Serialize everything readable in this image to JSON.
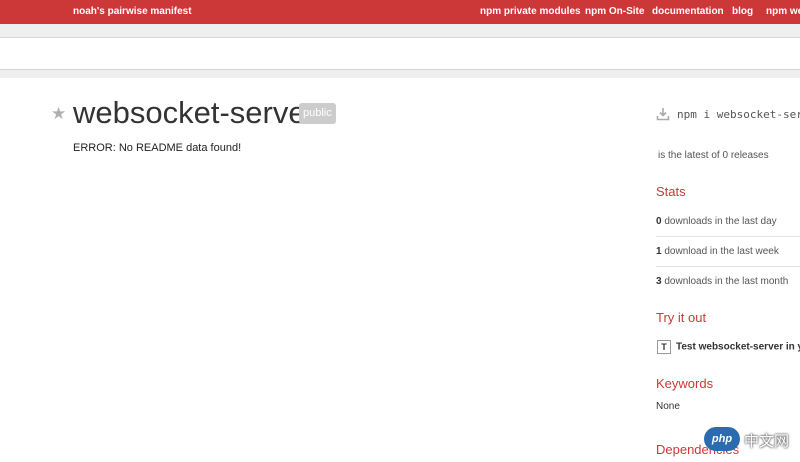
{
  "topbar": {
    "tagline": "noah's pairwise manifest",
    "nav": [
      "npm private modules",
      "npm On-Site",
      "documentation",
      "blog",
      "npm we"
    ]
  },
  "package": {
    "name": "websocket-server",
    "visibility": "public",
    "readme_error": "ERROR: No README data found!"
  },
  "sidebar": {
    "install_cmd": "npm i websocket-ser",
    "latest_text": "is the latest of 0 releases",
    "stats": {
      "title": "Stats",
      "rows": [
        {
          "count": "0",
          "label": "downloads in the last day"
        },
        {
          "count": "1",
          "label": "download in the last week"
        },
        {
          "count": "3",
          "label": "downloads in the last month"
        }
      ]
    },
    "try": {
      "title": "Try it out",
      "box_letter": "T",
      "text": "Test websocket-server in y"
    },
    "keywords": {
      "title": "Keywords",
      "value": "None"
    },
    "dependencies_title": "Dependencies"
  },
  "icons": {
    "star": "star-icon",
    "download": "download-icon"
  },
  "watermark": {
    "logo": "php",
    "text": "中文网"
  },
  "colors": {
    "brand": "#cb3837",
    "badge": "#cccccc"
  }
}
